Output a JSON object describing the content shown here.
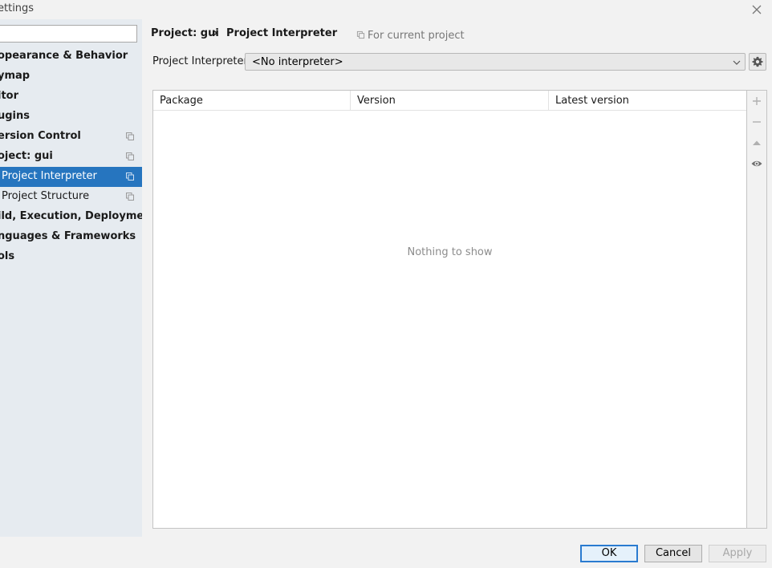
{
  "window": {
    "title": "ettings"
  },
  "sidebar": {
    "items": [
      {
        "label": "opearance & Behavior"
      },
      {
        "label": "ymap"
      },
      {
        "label": "itor"
      },
      {
        "label": "ugins"
      },
      {
        "label": "ersion Control"
      },
      {
        "label": "oject: gui"
      },
      {
        "label": "Project Interpreter"
      },
      {
        "label": "Project Structure"
      },
      {
        "label": "ild, Execution, Deployment"
      },
      {
        "label": "nguages & Frameworks"
      },
      {
        "label": "ols"
      }
    ]
  },
  "header": {
    "breadcrumb_parent": "Project: gui",
    "breadcrumb_separator": "›",
    "breadcrumb_current": "Project Interpreter",
    "scope": "For current project"
  },
  "interpreter": {
    "label": "Project Interpreter:",
    "value": "<No interpreter>"
  },
  "table": {
    "columns": [
      "Package",
      "Version",
      "Latest version"
    ],
    "empty_text": "Nothing to show"
  },
  "footer": {
    "ok_label": "OK",
    "cancel_label": "Cancel",
    "apply_label": "Apply"
  },
  "colors": {
    "selection": "#2675bf",
    "sidebar_bg": "#e6ebf0",
    "ok_border": "#2a7bd0"
  },
  "icons": [
    "close-icon",
    "copy-icon",
    "chevron-down-icon",
    "gear-icon",
    "plus-icon",
    "minus-icon",
    "up-arrow-icon",
    "eye-icon"
  ]
}
